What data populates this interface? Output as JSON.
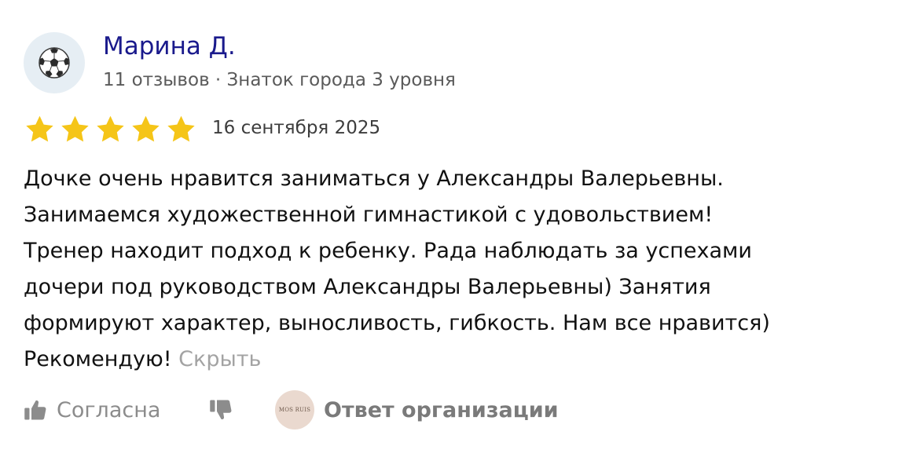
{
  "author": {
    "name": "Марина Д.",
    "meta": "11 отзывов · Знаток города 3 уровня",
    "avatar_icon": "soccer-ball-icon"
  },
  "rating": {
    "stars": 5,
    "max": 5,
    "star_color": "#f5c518"
  },
  "review": {
    "date": "16 сентября 2025",
    "lines": [
      "Дочке очень нравится заниматься у Александры Валерьевны.",
      "Занимаемся художественной гимнастикой с удовольствием!",
      "Тренер находит подход к ребенку. Рада наблюдать за успехами",
      "дочери под руководством Александры Валерьевны) Занятия",
      "формируют характер, выносливость, гибкость. Нам все нравится)",
      "Рекомендую!"
    ],
    "hide_label": "Скрыть"
  },
  "actions": {
    "like_label": "Согласна",
    "like_icon": "thumbs-up-icon",
    "dislike_icon": "thumbs-down-icon",
    "org_reply_label": "Ответ организации",
    "org_logo_text": "MOS RUIS"
  },
  "colors": {
    "author_name": "#1a1a8c",
    "muted": "#8c8c8c",
    "link_muted": "#a3a3a3"
  }
}
